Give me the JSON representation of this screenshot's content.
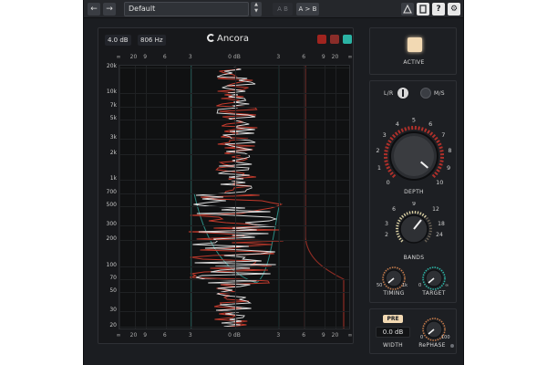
{
  "topbar": {
    "preset_name": "Default",
    "ab_compare": "A B",
    "ab_copy": "A > B",
    "icons": [
      "arrow-left-icon",
      "arrow-right-icon",
      "warning-icon",
      "manual-icon",
      "help-icon",
      "settings-icon"
    ]
  },
  "header": {
    "gain_readout": "4.0 dB",
    "freq_readout": "806 Hz",
    "logo_text": "Ancora",
    "colors": {
      "sq1": "#a0241f",
      "sq2": "#a0241f",
      "sq3": "#2bb3a4"
    }
  },
  "plot": {
    "top_axis": [
      "∞",
      "20",
      "9",
      "6",
      "3",
      "0 dB",
      "3",
      "6",
      "9",
      "20",
      "∞"
    ],
    "bottom_axis": [
      "∞",
      "20",
      "9",
      "6",
      "3",
      "0 dB",
      "3",
      "6",
      "9",
      "20",
      "∞"
    ],
    "freq_labels": [
      "20k",
      "10k",
      "7k",
      "5k",
      "3k",
      "2k",
      "1k",
      "700",
      "500",
      "300",
      "200",
      "100",
      "70",
      "50",
      "30",
      "20"
    ]
  },
  "active": {
    "label": "ACTIVE"
  },
  "mode": {
    "lr_label": "L/R",
    "ms_label": "M/S"
  },
  "depth": {
    "label": "DEPTH",
    "scale": [
      "0",
      "1",
      "2",
      "3",
      "4",
      "5",
      "6",
      "7",
      "8",
      "9",
      "10"
    ]
  },
  "bands": {
    "label": "BANDS",
    "scale": [
      "2",
      "3",
      "6",
      "9",
      "12",
      "18",
      "24"
    ]
  },
  "timing": {
    "label": "TIMING",
    "min": "50",
    "max": "1k"
  },
  "target": {
    "label": "TARGET",
    "min": "0",
    "max": "∞"
  },
  "width": {
    "pre_label": "PRE",
    "value": "0.0 dB",
    "label": "WIDTH"
  },
  "rephase": {
    "label": "RePHASE",
    "min": "0",
    "max": "100"
  }
}
